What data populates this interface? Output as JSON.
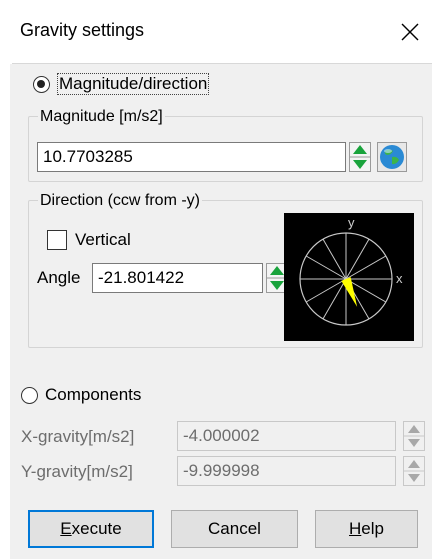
{
  "window": {
    "title": "Gravity settings",
    "close_icon": "close-icon"
  },
  "magnitude_direction": {
    "radio_label": "Magnitude/direction",
    "selected": true,
    "magnitude_group_label": "Magnitude [m/s2]",
    "magnitude_value": "10.7703285",
    "direction_group_label": "Direction (ccw from -y)",
    "vertical_label": "Vertical",
    "vertical_checked": false,
    "angle_label": "Angle",
    "angle_value": "-21.801422",
    "compass": {
      "y_label": "y",
      "x_label": "x",
      "angle_deg": -21.801422,
      "colors": {
        "background": "#000000",
        "circle": "#c8c8c8",
        "arrow": "#ffff00"
      }
    }
  },
  "components": {
    "radio_label": "Components",
    "selected": false,
    "x_label": "X-gravity[m/s2]",
    "x_value": "-4.000002",
    "y_label": "Y-gravity[m/s2]",
    "y_value": "-9.999998"
  },
  "buttons": {
    "execute": {
      "prefix": "",
      "mnemonic": "E",
      "rest": "xecute"
    },
    "cancel": {
      "label": "Cancel"
    },
    "help": {
      "prefix": "",
      "mnemonic": "H",
      "rest": "elp"
    }
  },
  "icons": {
    "spinner": "spinner-icon",
    "globe": "globe-icon"
  },
  "colors": {
    "focus_border": "#0078d7",
    "spinner_arrow": "#19a33c"
  }
}
